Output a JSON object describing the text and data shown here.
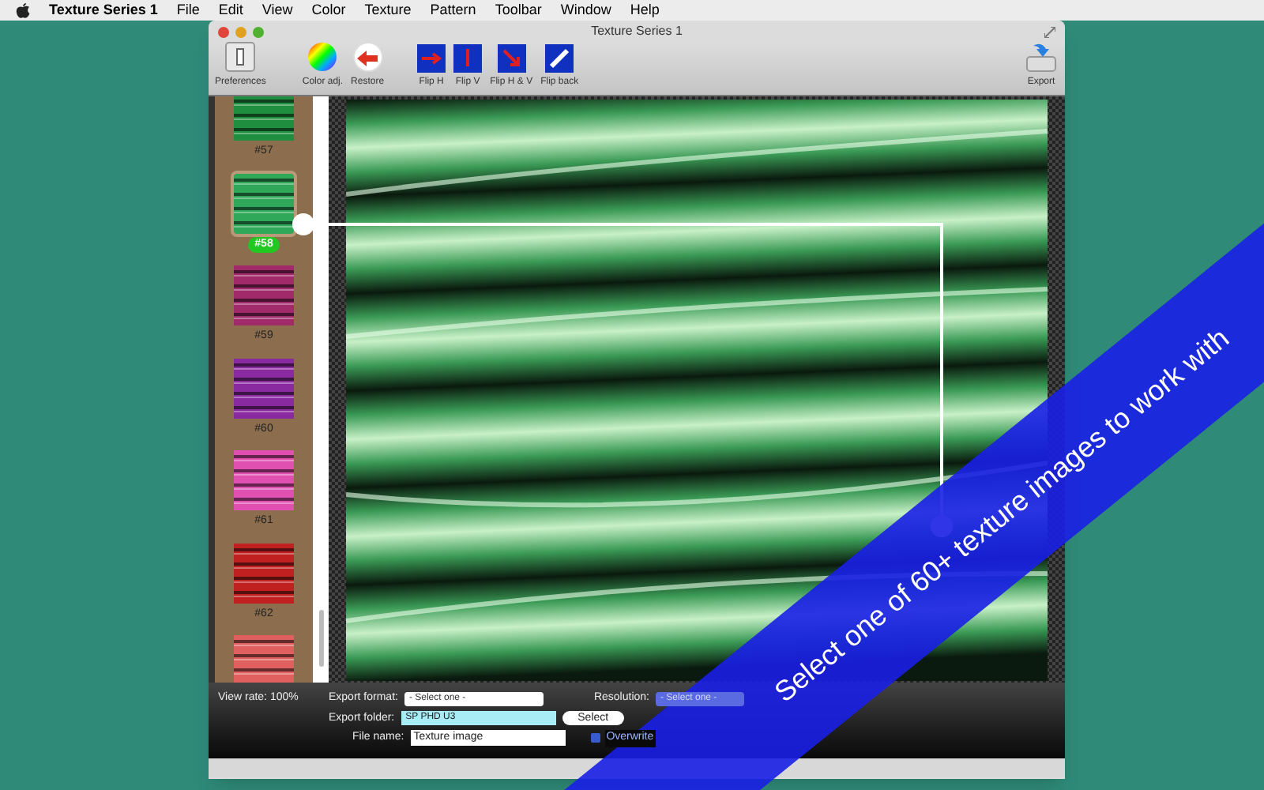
{
  "menu_bar": {
    "app": "Texture Series 1",
    "items": [
      "File",
      "Edit",
      "View",
      "Color",
      "Texture",
      "Pattern",
      "Toolbar",
      "Window",
      "Help"
    ]
  },
  "window": {
    "title": "Texture Series 1"
  },
  "toolbar": [
    {
      "label": "Preferences",
      "kind": "prefs"
    },
    {
      "label": "Color adj.",
      "kind": "color"
    },
    {
      "label": "Restore",
      "kind": "restore"
    },
    {
      "label": "Flip H",
      "kind": "fliph"
    },
    {
      "label": "Flip V",
      "kind": "flipv"
    },
    {
      "label": "Flip H & V",
      "kind": "fliphv"
    },
    {
      "label": "Flip back",
      "kind": "flipback"
    },
    {
      "label": "Export",
      "kind": "export"
    }
  ],
  "thumbnails": [
    {
      "label": "#57",
      "color": "#1f8f3f",
      "selected": false
    },
    {
      "label": "#58",
      "color": "#2fa85a",
      "selected": true
    },
    {
      "label": "#59",
      "color": "#a02a6a",
      "selected": false
    },
    {
      "label": "#60",
      "color": "#8a2aa0",
      "selected": false
    },
    {
      "label": "#61",
      "color": "#e050b0",
      "selected": false
    },
    {
      "label": "#62",
      "color": "#c02020",
      "selected": false
    },
    {
      "color": "#e06060",
      "selected": false
    }
  ],
  "bottom_panel": {
    "view_rate": "View rate: 100%",
    "export_format": {
      "label": "Export format:",
      "value": "- Select one -"
    },
    "resolution": {
      "label": "Resolution:",
      "placeholder": "- Select one -"
    },
    "export_folder": {
      "label": "Export folder:",
      "value": "SP PHD U3"
    },
    "select_button": "Select",
    "file_name": {
      "label": "File name:",
      "value": "Texture image"
    },
    "overwrite": {
      "label": "Overwrite",
      "checked": true
    }
  },
  "banner": "Select one of 60+ texture images to work with"
}
